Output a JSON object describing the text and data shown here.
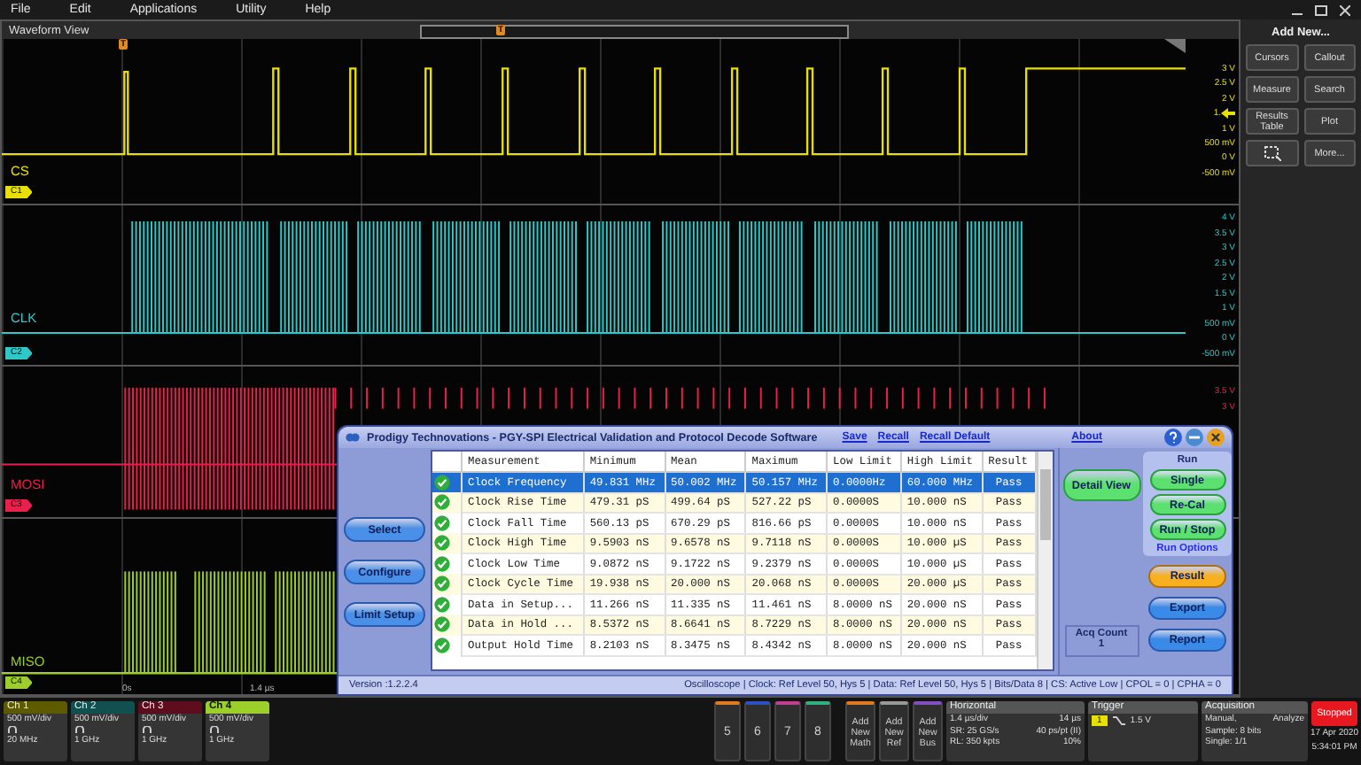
{
  "menu": [
    "File",
    "Edit",
    "Applications",
    "Utility",
    "Help"
  ],
  "waveform_view": {
    "title": "Waveform View",
    "overview_marker": "T",
    "trigger_marker": "T",
    "time_labels": [
      "0s",
      "1.4 µs"
    ],
    "lanes": [
      {
        "kind": "cs",
        "name": "CS",
        "badge": "C1",
        "color": "#e8e000",
        "axis_labels": [
          {
            "text": "3 V",
            "marker": false
          },
          {
            "text": "2.5 V",
            "marker": false
          },
          {
            "text": "2 V",
            "marker": false
          },
          {
            "text": "1.",
            "marker": true
          },
          {
            "text": "1 V",
            "marker": false
          },
          {
            "text": "500 mV",
            "marker": false
          },
          {
            "text": "0 V",
            "marker": false
          },
          {
            "text": "-500 mV",
            "marker": false
          }
        ]
      },
      {
        "kind": "clk",
        "name": "CLK",
        "badge": "C2",
        "color": "#2ec8c8",
        "axis_labels": [
          {
            "text": "4 V",
            "marker": false
          },
          {
            "text": "3.5 V",
            "marker": false
          },
          {
            "text": "3 V",
            "marker": false
          },
          {
            "text": "2.5 V",
            "marker": false
          },
          {
            "text": "2 V",
            "marker": false
          },
          {
            "text": "1.5 V",
            "marker": false
          },
          {
            "text": "1 V",
            "marker": false
          },
          {
            "text": "500 mV",
            "marker": false
          },
          {
            "text": "0 V",
            "marker": false
          },
          {
            "text": "-500 mV",
            "marker": false
          }
        ]
      },
      {
        "kind": "mosi",
        "name": "MOSI",
        "badge": "C3",
        "color": "#e8204c",
        "axis_labels": [
          {
            "text": "3.5 V",
            "marker": false
          },
          {
            "text": "3 V",
            "marker": false
          }
        ]
      },
      {
        "kind": "miso",
        "name": "MISO",
        "badge": "C4",
        "color": "#9ccf2c"
      }
    ]
  },
  "side_panel": {
    "title": "Add New...",
    "buttons": [
      {
        "kind": "text",
        "label": "Cursors"
      },
      {
        "kind": "text",
        "label": "Callout"
      },
      {
        "kind": "text",
        "label": "Measure"
      },
      {
        "kind": "text",
        "label": "Search"
      },
      {
        "kind": "text",
        "label": "Results Table"
      },
      {
        "kind": "text",
        "label": "Plot"
      },
      {
        "kind": "icon"
      },
      {
        "kind": "text",
        "label": "More..."
      }
    ]
  },
  "dialog": {
    "title": "Prodigy Technovations - PGY-SPI Electrical Validation and Protocol Decode Software",
    "links": [
      "Save",
      "Recall",
      "Recall Default"
    ],
    "about_link": "About",
    "nav_buttons": [
      "Select",
      "Configure",
      "Limit Setup"
    ],
    "columns": [
      "Measurement",
      "Minimum",
      "Mean",
      "Maximum",
      "Low Limit",
      "High Limit",
      "Result"
    ],
    "rows": [
      {
        "selected": true,
        "cells": [
          "Clock Frequency",
          "49.831 MHz",
          "50.002 MHz",
          "50.157 MHz",
          "0.0000Hz",
          "60.000 MHz",
          "Pass"
        ]
      },
      {
        "selected": false,
        "cells": [
          "Clock Rise Time",
          "479.31 pS",
          "499.64 pS",
          "527.22 pS",
          "0.0000S",
          "10.000 nS",
          "Pass"
        ]
      },
      {
        "selected": false,
        "cells": [
          "Clock Fall Time",
          "560.13 pS",
          "670.29 pS",
          "816.66 pS",
          "0.0000S",
          "10.000 nS",
          "Pass"
        ]
      },
      {
        "selected": false,
        "cells": [
          "Clock High Time",
          "9.5903 nS",
          "9.6578 nS",
          "9.7118 nS",
          "0.0000S",
          "10.000 µS",
          "Pass"
        ]
      },
      {
        "selected": false,
        "cells": [
          "Clock Low Time",
          "9.0872 nS",
          "9.1722 nS",
          "9.2379 nS",
          "0.0000S",
          "10.000 µS",
          "Pass"
        ]
      },
      {
        "selected": false,
        "cells": [
          "Clock Cycle Time",
          "19.938 nS",
          "20.000 nS",
          "20.068 nS",
          "0.0000S",
          "20.000 µS",
          "Pass"
        ]
      },
      {
        "selected": false,
        "cells": [
          "Data in Setup...",
          "11.266 nS",
          "11.335 nS",
          "11.461 nS",
          "8.0000 nS",
          "20.000 nS",
          "Pass"
        ]
      },
      {
        "selected": false,
        "cells": [
          "Data in Hold ...",
          "8.5372 nS",
          "8.6641 nS",
          "8.7229 nS",
          "8.0000 nS",
          "20.000 nS",
          "Pass"
        ]
      },
      {
        "selected": false,
        "cells": [
          "Output Hold Time",
          "8.2103 nS",
          "8.3475 nS",
          "8.4342 nS",
          "8.0000 nS",
          "20.000 nS",
          "Pass"
        ]
      }
    ],
    "detail_button": "Detail View",
    "acq_count": {
      "label": "Acq Count",
      "value": "1"
    },
    "run": {
      "title": "Run",
      "buttons": [
        "Single",
        "Re-Cal",
        "Run / Stop"
      ],
      "options_link": "Run Options"
    },
    "tabs": [
      {
        "label": "Result",
        "selected": true
      },
      {
        "label": "Export",
        "selected": false
      },
      {
        "label": "Report",
        "selected": false
      }
    ],
    "version": "Version :1.2.2.4",
    "status": "Oscilloscope  | Clock: Ref Level 50, Hys 5 | Data: Ref Level 50, Hys 5 | Bits/Data 8 | CS: Active Low  | CPOL = 0  | CPHA = 0"
  },
  "channels": [
    {
      "label": "Ch 1",
      "color": "#5d5a00",
      "selected": false,
      "scale": "500 mV/div",
      "bandwidth": "20 MHz"
    },
    {
      "label": "Ch 2",
      "color": "#125050",
      "selected": false,
      "scale": "500 mV/div",
      "bandwidth": "1 GHz"
    },
    {
      "label": "Ch 3",
      "color": "#5d0d1e",
      "selected": false,
      "scale": "500 mV/div",
      "bandwidth": "1 GHz"
    },
    {
      "label": "Ch 4",
      "color": "#9ccf2c",
      "selected": true,
      "scale": "500 mV/div",
      "bandwidth": "1 GHz"
    }
  ],
  "slots": [
    {
      "label": "5",
      "color": "#e07a20"
    },
    {
      "label": "6",
      "color": "#3050c0"
    },
    {
      "label": "7",
      "color": "#c04090"
    },
    {
      "label": "8",
      "color": "#30b080"
    }
  ],
  "add_buttons": [
    {
      "label": "Add New Math",
      "color": "#e07a20"
    },
    {
      "label": "Add New Ref",
      "color": "#999999"
    },
    {
      "label": "Add New Bus",
      "color": "#8050c0"
    }
  ],
  "horizontal": {
    "title": "Horizontal",
    "rows": [
      [
        "1.4 µs/div",
        "14 µs"
      ],
      [
        "SR: 25 GS/s",
        "40 ps/pt (II)"
      ],
      [
        "RL: 350 kpts",
        "10%"
      ]
    ]
  },
  "trigger": {
    "title": "Trigger",
    "source": "1",
    "level": "1.5 V"
  },
  "acquisition": {
    "title": "Acquisition",
    "lines": [
      [
        "Manual,",
        "Analyze"
      ],
      [
        "Sample: 8 bits"
      ],
      [
        "Single: 1/1"
      ]
    ]
  },
  "run_state": "Stopped",
  "date": "17 Apr 2020",
  "time": "5:34:01 PM"
}
